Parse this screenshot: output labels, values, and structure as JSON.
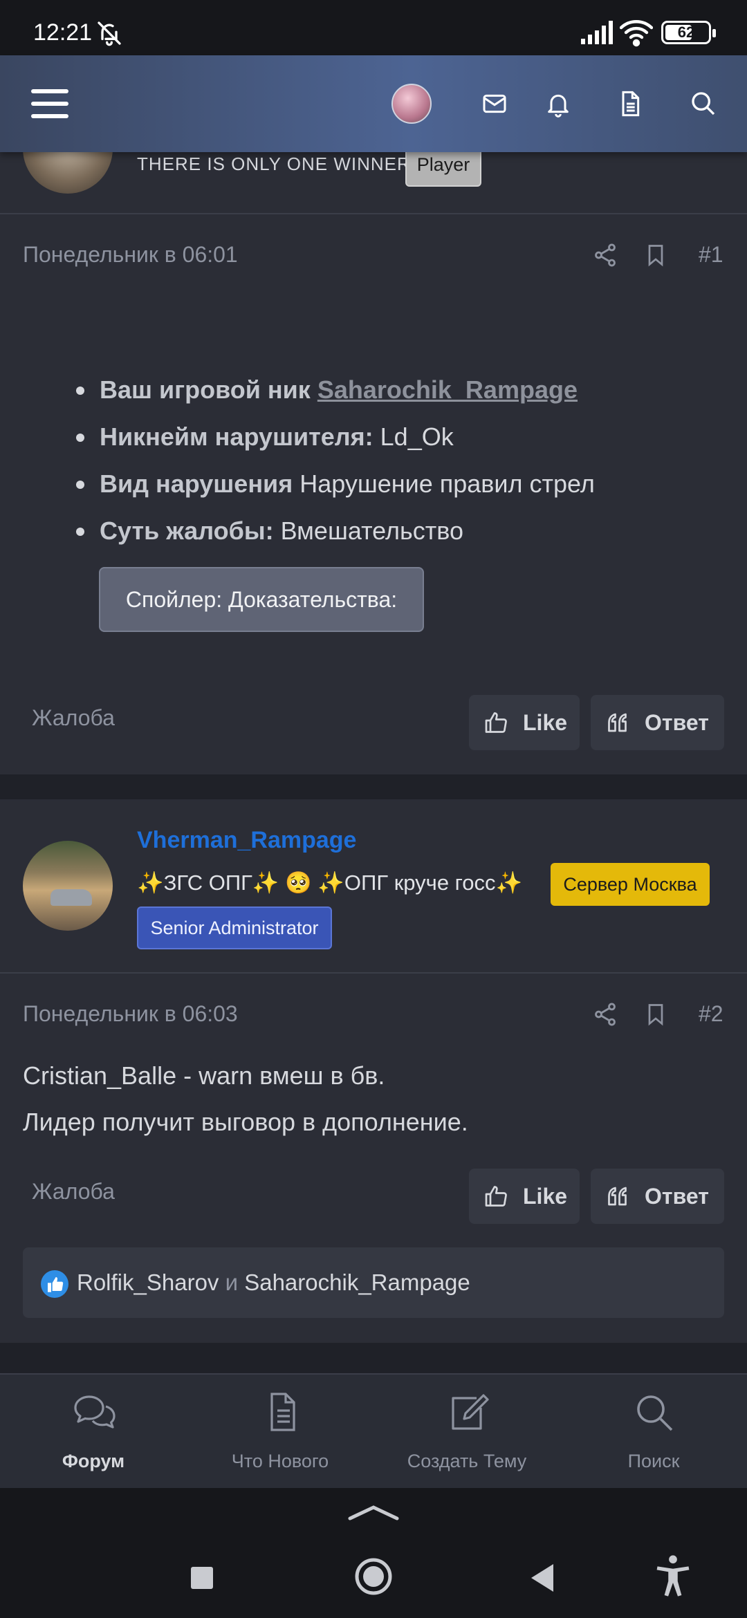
{
  "status_bar": {
    "time": "12:21",
    "battery": "62"
  },
  "top_bar": {
    "icons": [
      "menu-icon",
      "avatar",
      "mail-icon",
      "bell-icon",
      "document-icon",
      "search-icon"
    ]
  },
  "post1": {
    "user_title": "THERE IS ONLY ONE WINNER",
    "badge": "Player",
    "date": "Понедельник в 06:01",
    "number": "#1",
    "fields": [
      {
        "label": "Ваш игровой ник",
        "value": "Saharochik_Rampage",
        "value_is_link": true
      },
      {
        "label": "Никнейм нарушителя:",
        "value": "Ld_Ok"
      },
      {
        "label": "Вид нарушения",
        "value": "Нарушение правил стрел"
      },
      {
        "label": "Суть жалобы:",
        "value": "Вмешательство"
      }
    ],
    "spoiler": "Спойлер: Доказательства:",
    "report": "Жалоба",
    "like": "Like",
    "reply": "Ответ"
  },
  "post2": {
    "username": "Vherman_Rampage",
    "user_title": "✨ЗГС ОПГ✨ 🥺 ✨ОПГ круче госс✨",
    "badge_server": "Сервер Москва",
    "badge_role": "Senior Administrator",
    "date": "Понедельник в 06:03",
    "number": "#2",
    "lines": [
      "Cristian_Balle - warn вмеш в бв.",
      "Лидер получит выговор в дополнение."
    ],
    "report": "Жалоба",
    "like": "Like",
    "reply": "Ответ",
    "likes": {
      "user1": "Rolfik_Sharov",
      "and": "и",
      "user2": "Saharochik_Rampage"
    }
  },
  "bottom_nav": [
    {
      "label": "Форум",
      "icon": "chat-bubbles-icon",
      "active": true
    },
    {
      "label": "Что Нового",
      "icon": "document-icon",
      "active": false
    },
    {
      "label": "Создать Тему",
      "icon": "edit-icon",
      "active": false
    },
    {
      "label": "Поиск",
      "icon": "search-icon",
      "active": false
    }
  ],
  "colors": {
    "background": "#1f2128",
    "post": "#2b2d36",
    "username": "#1e6fd9",
    "server_badge": "#e4b90a",
    "admin_badge": "#3a55b6"
  }
}
